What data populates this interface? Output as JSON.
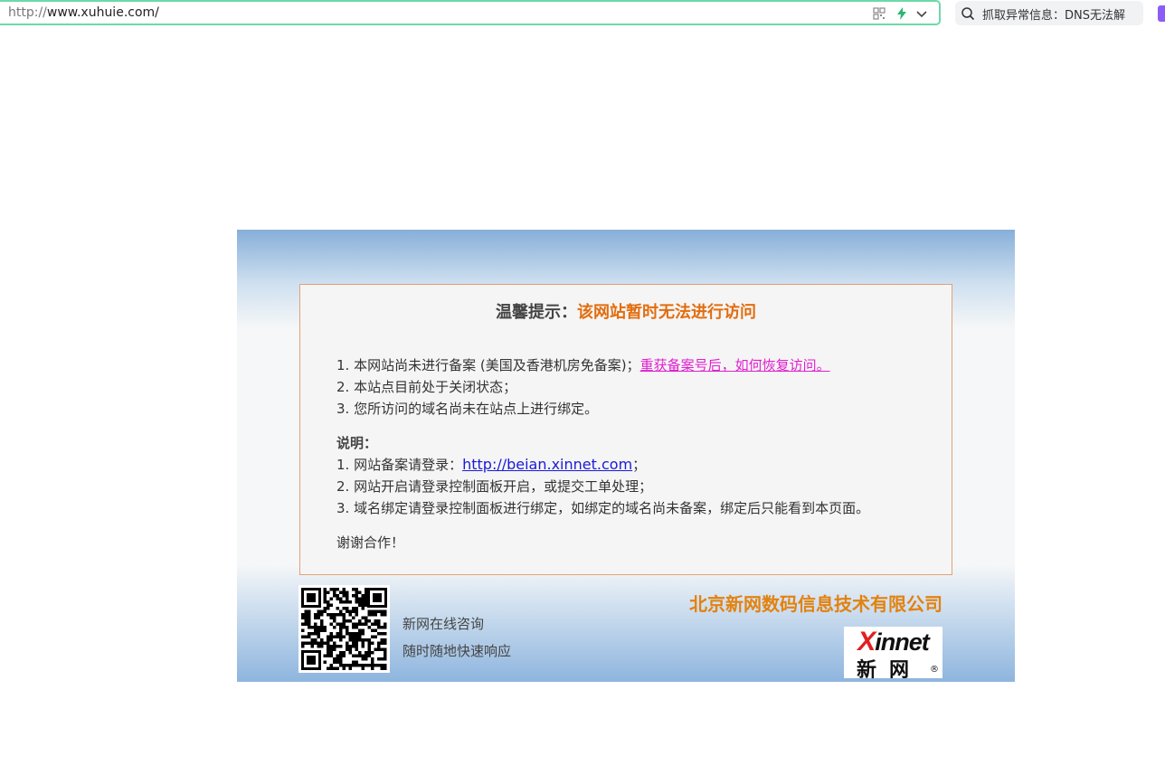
{
  "browser": {
    "url_protocol": "http://",
    "url_rest": "www.xuhuie.com/",
    "search_text": "抓取异常信息：DNS无法解",
    "accent_color": "#6fd8a9"
  },
  "notice": {
    "title_prefix": "温馨提示：",
    "title_highlight": "该网站暂时无法进行访问",
    "items": [
      "1. 本网站尚未进行备案 (美国及香港机房免备案)；",
      "2. 本站点目前处于关闭状态；",
      "3. 您所访问的域名尚未在站点上进行绑定。"
    ],
    "item1_link": "重获备案号后，如何恢复访问。",
    "explain_heading": "说明：",
    "explain_1_prefix": "1. 网站备案请登录：",
    "explain_1_link": "http://beian.xinnet.com",
    "explain_1_suffix": "；",
    "explain_2": "2. 网站开启请登录控制面板开启，或提交工单处理；",
    "explain_3": "3. 域名绑定请登录控制面板进行绑定，如绑定的域名尚未备案，绑定后只能看到本页面。",
    "thanks": "谢谢合作！"
  },
  "footer": {
    "consult_line1": "新网在线咨询",
    "consult_line2": "随时随地快速响应",
    "company": "北京新网数码信息技术有限公司",
    "logo_en_x": "X",
    "logo_en_rest": "innet",
    "logo_cn": "新网",
    "logo_reg": "®"
  }
}
